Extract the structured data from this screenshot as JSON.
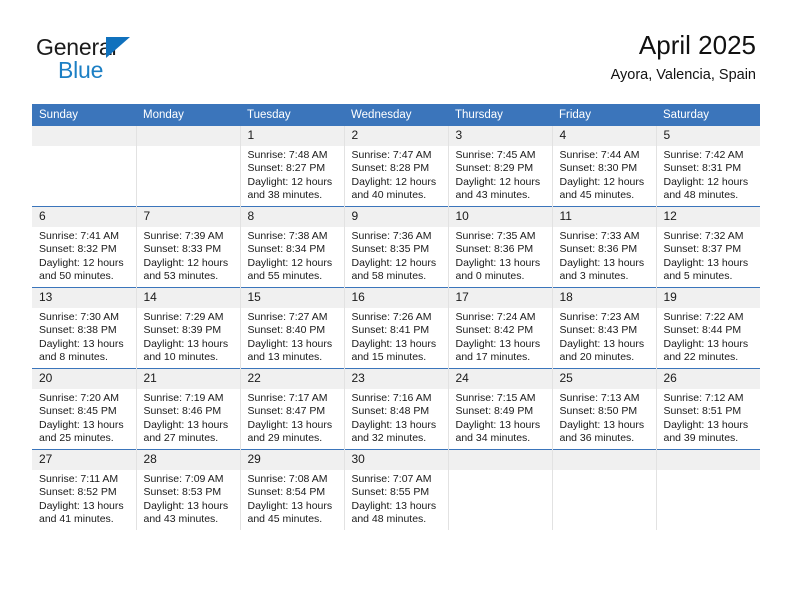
{
  "brand": {
    "line1": "General",
    "line2": "Blue",
    "triangle_color": "#1071bd",
    "text_color": "#1c7fc4"
  },
  "header": {
    "title": "April 2025",
    "subtitle": "Ayora, Valencia, Spain"
  },
  "colors": {
    "header_blue": "#3b75bb",
    "daynum_bg": "#f0f0f0",
    "grid_line": "#e2e2e2"
  },
  "calendar": {
    "weekday_headers": [
      "Sunday",
      "Monday",
      "Tuesday",
      "Wednesday",
      "Thursday",
      "Friday",
      "Saturday"
    ],
    "weeks": [
      [
        {
          "day": "",
          "empty": true
        },
        {
          "day": "",
          "empty": true
        },
        {
          "day": "1",
          "sunrise": "Sunrise: 7:48 AM",
          "sunset": "Sunset: 8:27 PM",
          "daylight": "Daylight: 12 hours and 38 minutes."
        },
        {
          "day": "2",
          "sunrise": "Sunrise: 7:47 AM",
          "sunset": "Sunset: 8:28 PM",
          "daylight": "Daylight: 12 hours and 40 minutes."
        },
        {
          "day": "3",
          "sunrise": "Sunrise: 7:45 AM",
          "sunset": "Sunset: 8:29 PM",
          "daylight": "Daylight: 12 hours and 43 minutes."
        },
        {
          "day": "4",
          "sunrise": "Sunrise: 7:44 AM",
          "sunset": "Sunset: 8:30 PM",
          "daylight": "Daylight: 12 hours and 45 minutes."
        },
        {
          "day": "5",
          "sunrise": "Sunrise: 7:42 AM",
          "sunset": "Sunset: 8:31 PM",
          "daylight": "Daylight: 12 hours and 48 minutes."
        }
      ],
      [
        {
          "day": "6",
          "sunrise": "Sunrise: 7:41 AM",
          "sunset": "Sunset: 8:32 PM",
          "daylight": "Daylight: 12 hours and 50 minutes."
        },
        {
          "day": "7",
          "sunrise": "Sunrise: 7:39 AM",
          "sunset": "Sunset: 8:33 PM",
          "daylight": "Daylight: 12 hours and 53 minutes."
        },
        {
          "day": "8",
          "sunrise": "Sunrise: 7:38 AM",
          "sunset": "Sunset: 8:34 PM",
          "daylight": "Daylight: 12 hours and 55 minutes."
        },
        {
          "day": "9",
          "sunrise": "Sunrise: 7:36 AM",
          "sunset": "Sunset: 8:35 PM",
          "daylight": "Daylight: 12 hours and 58 minutes."
        },
        {
          "day": "10",
          "sunrise": "Sunrise: 7:35 AM",
          "sunset": "Sunset: 8:36 PM",
          "daylight": "Daylight: 13 hours and 0 minutes."
        },
        {
          "day": "11",
          "sunrise": "Sunrise: 7:33 AM",
          "sunset": "Sunset: 8:36 PM",
          "daylight": "Daylight: 13 hours and 3 minutes."
        },
        {
          "day": "12",
          "sunrise": "Sunrise: 7:32 AM",
          "sunset": "Sunset: 8:37 PM",
          "daylight": "Daylight: 13 hours and 5 minutes."
        }
      ],
      [
        {
          "day": "13",
          "sunrise": "Sunrise: 7:30 AM",
          "sunset": "Sunset: 8:38 PM",
          "daylight": "Daylight: 13 hours and 8 minutes."
        },
        {
          "day": "14",
          "sunrise": "Sunrise: 7:29 AM",
          "sunset": "Sunset: 8:39 PM",
          "daylight": "Daylight: 13 hours and 10 minutes."
        },
        {
          "day": "15",
          "sunrise": "Sunrise: 7:27 AM",
          "sunset": "Sunset: 8:40 PM",
          "daylight": "Daylight: 13 hours and 13 minutes."
        },
        {
          "day": "16",
          "sunrise": "Sunrise: 7:26 AM",
          "sunset": "Sunset: 8:41 PM",
          "daylight": "Daylight: 13 hours and 15 minutes."
        },
        {
          "day": "17",
          "sunrise": "Sunrise: 7:24 AM",
          "sunset": "Sunset: 8:42 PM",
          "daylight": "Daylight: 13 hours and 17 minutes."
        },
        {
          "day": "18",
          "sunrise": "Sunrise: 7:23 AM",
          "sunset": "Sunset: 8:43 PM",
          "daylight": "Daylight: 13 hours and 20 minutes."
        },
        {
          "day": "19",
          "sunrise": "Sunrise: 7:22 AM",
          "sunset": "Sunset: 8:44 PM",
          "daylight": "Daylight: 13 hours and 22 minutes."
        }
      ],
      [
        {
          "day": "20",
          "sunrise": "Sunrise: 7:20 AM",
          "sunset": "Sunset: 8:45 PM",
          "daylight": "Daylight: 13 hours and 25 minutes."
        },
        {
          "day": "21",
          "sunrise": "Sunrise: 7:19 AM",
          "sunset": "Sunset: 8:46 PM",
          "daylight": "Daylight: 13 hours and 27 minutes."
        },
        {
          "day": "22",
          "sunrise": "Sunrise: 7:17 AM",
          "sunset": "Sunset: 8:47 PM",
          "daylight": "Daylight: 13 hours and 29 minutes."
        },
        {
          "day": "23",
          "sunrise": "Sunrise: 7:16 AM",
          "sunset": "Sunset: 8:48 PM",
          "daylight": "Daylight: 13 hours and 32 minutes."
        },
        {
          "day": "24",
          "sunrise": "Sunrise: 7:15 AM",
          "sunset": "Sunset: 8:49 PM",
          "daylight": "Daylight: 13 hours and 34 minutes."
        },
        {
          "day": "25",
          "sunrise": "Sunrise: 7:13 AM",
          "sunset": "Sunset: 8:50 PM",
          "daylight": "Daylight: 13 hours and 36 minutes."
        },
        {
          "day": "26",
          "sunrise": "Sunrise: 7:12 AM",
          "sunset": "Sunset: 8:51 PM",
          "daylight": "Daylight: 13 hours and 39 minutes."
        }
      ],
      [
        {
          "day": "27",
          "sunrise": "Sunrise: 7:11 AM",
          "sunset": "Sunset: 8:52 PM",
          "daylight": "Daylight: 13 hours and 41 minutes."
        },
        {
          "day": "28",
          "sunrise": "Sunrise: 7:09 AM",
          "sunset": "Sunset: 8:53 PM",
          "daylight": "Daylight: 13 hours and 43 minutes."
        },
        {
          "day": "29",
          "sunrise": "Sunrise: 7:08 AM",
          "sunset": "Sunset: 8:54 PM",
          "daylight": "Daylight: 13 hours and 45 minutes."
        },
        {
          "day": "30",
          "sunrise": "Sunrise: 7:07 AM",
          "sunset": "Sunset: 8:55 PM",
          "daylight": "Daylight: 13 hours and 48 minutes."
        },
        {
          "day": "",
          "empty": true
        },
        {
          "day": "",
          "empty": true
        },
        {
          "day": "",
          "empty": true
        }
      ]
    ]
  }
}
